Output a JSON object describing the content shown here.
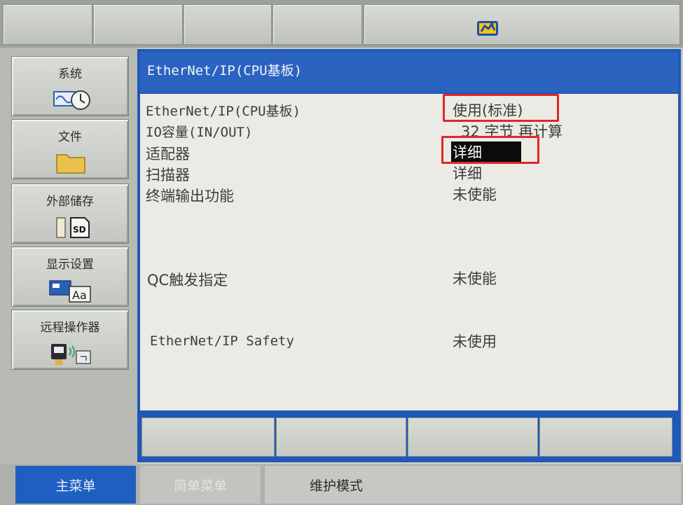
{
  "panel": {
    "title": "EtherNet/IP(CPU基板)"
  },
  "sidebar": {
    "items": [
      {
        "label": "系统",
        "icon": "clock-wave-icon"
      },
      {
        "label": "文件",
        "icon": "folder-icon"
      },
      {
        "label": "外部储存",
        "icon": "sd-card-icon"
      },
      {
        "label": "显示设置",
        "icon": "display-font-icon"
      },
      {
        "label": "远程操作器",
        "icon": "remote-device-icon"
      }
    ]
  },
  "settings": {
    "rows": [
      {
        "label": "EtherNet/IP(CPU基板)",
        "value": "使用(标准)"
      },
      {
        "label": "IO容量(IN/OUT)",
        "value": "32 字节 再计算"
      },
      {
        "label": "适配器",
        "value": "详细"
      },
      {
        "label": "扫描器",
        "value": "详细"
      },
      {
        "label": "终端输出功能",
        "value": "未使能"
      },
      {
        "label": "QC触发指定",
        "value": "未使能"
      },
      {
        "label": "EtherNet/IP Safety",
        "value": "未使用"
      }
    ]
  },
  "bottom": {
    "main_menu": "主菜单",
    "second": "简单菜单",
    "maintenance": "维护模式"
  },
  "colors": {
    "title_bar": "#2a63c0",
    "highlight_box": "#e0272a",
    "selected_bg": "#0b0b0b"
  }
}
